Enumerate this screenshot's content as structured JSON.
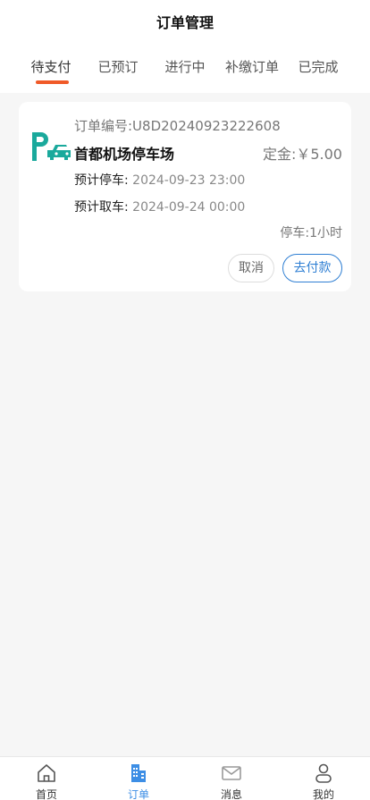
{
  "header": {
    "title": "订单管理"
  },
  "tabs": [
    {
      "label": "待支付",
      "active": true
    },
    {
      "label": "已预订",
      "active": false
    },
    {
      "label": "进行中",
      "active": false
    },
    {
      "label": "补缴订单",
      "active": false
    },
    {
      "label": "已完成",
      "active": false
    }
  ],
  "order": {
    "order_no": "订单编号:U8D20240923222608",
    "lot_name": "首都机场停车场",
    "deposit": "定金:￥5.00",
    "park_label": "预计停车:",
    "park_time": "2024-09-23 23:00",
    "pickup_label": "预计取车:",
    "pickup_time": "2024-09-24 00:00",
    "duration": "停车:1小时",
    "logo_icon": "parking-car-icon",
    "cancel_label": "取消",
    "pay_label": "去付款"
  },
  "nav": [
    {
      "label": "首页",
      "icon": "home-icon",
      "active": false
    },
    {
      "label": "订单",
      "icon": "order-building-icon",
      "active": true
    },
    {
      "label": "消息",
      "icon": "mail-icon",
      "active": false
    },
    {
      "label": "我的",
      "icon": "user-icon",
      "active": false
    }
  ],
  "colors": {
    "accent": "#f05a28",
    "brand_blue": "#2f7fd3",
    "logo_teal": "#1aa99c",
    "nav_active": "#3d8ee5"
  }
}
